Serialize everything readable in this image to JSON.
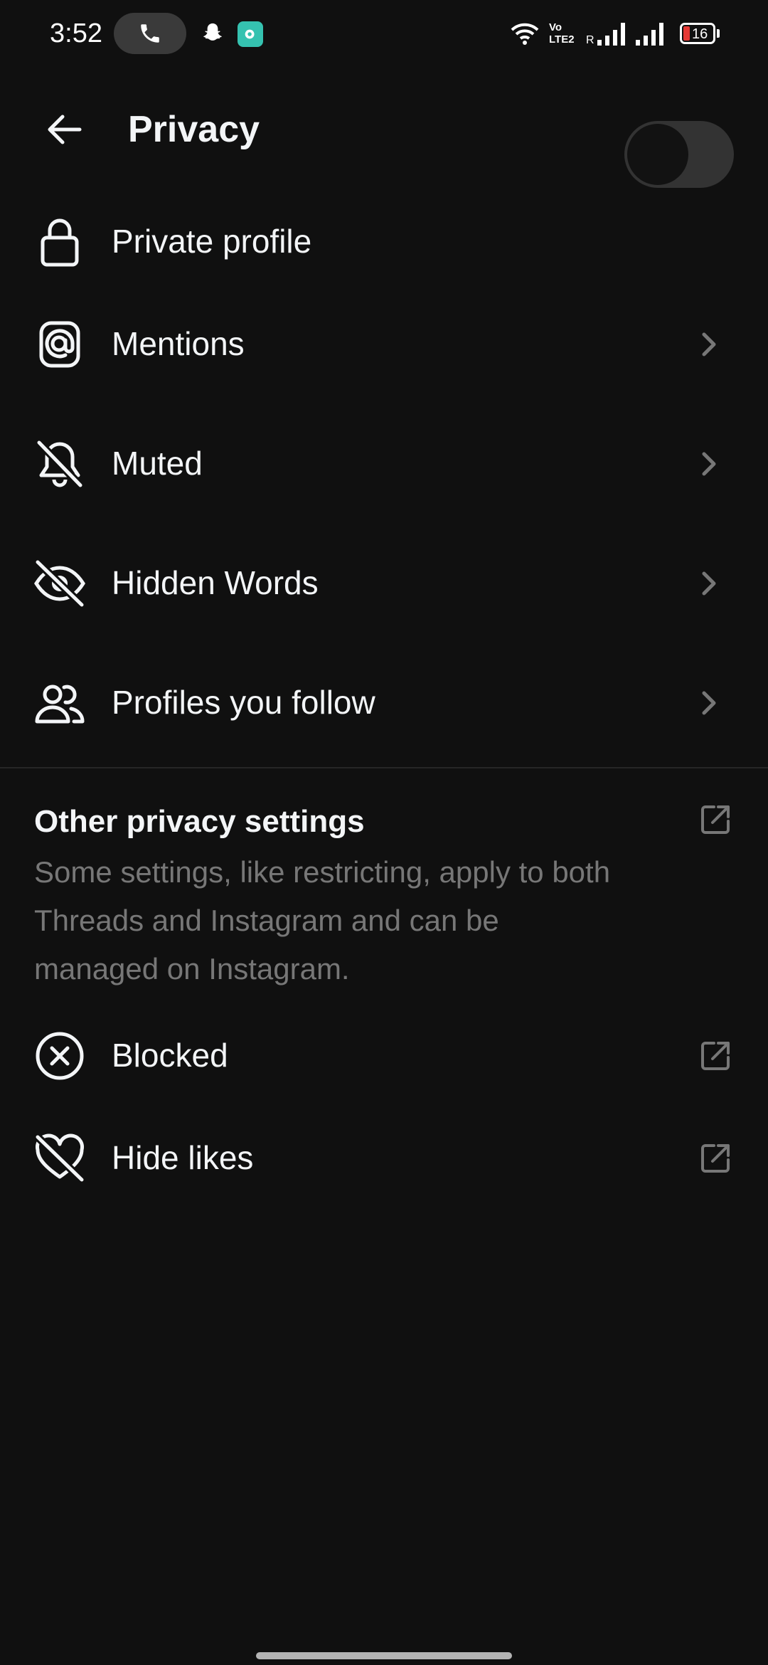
{
  "status_bar": {
    "time": "3:52",
    "icons": [
      "phone-icon",
      "snapchat-icon",
      "app-icon",
      "wifi-icon",
      "volte-icon",
      "signal-icon",
      "signal-icon",
      "battery-icon"
    ],
    "volte_top": "Vo",
    "volte_bottom": "LTE2",
    "roaming": "R",
    "battery_level": "16",
    "battery_color": "#e53935",
    "app_icon_color": "#35c2b0"
  },
  "header": {
    "title": "Privacy",
    "back_icon": "back-arrow-icon"
  },
  "settings": {
    "private_profile": {
      "label": "Private profile",
      "icon": "lock-icon",
      "toggle_on": false
    },
    "mentions": {
      "label": "Mentions",
      "icon": "at-icon"
    },
    "muted": {
      "label": "Muted",
      "icon": "bell-off-icon"
    },
    "hidden_words": {
      "label": "Hidden Words",
      "icon": "eye-off-icon"
    },
    "profiles_you_follow": {
      "label": "Profiles you follow",
      "icon": "people-icon"
    }
  },
  "other_privacy": {
    "title": "Other privacy settings",
    "description": "Some settings, like restricting, apply to both Threads and Instagram and can be managed on Instagram.",
    "items": {
      "blocked": {
        "label": "Blocked",
        "icon": "x-circle-icon"
      },
      "hide_likes": {
        "label": "Hide likes",
        "icon": "heart-off-icon"
      }
    }
  },
  "colors": {
    "background": "#101010",
    "text_primary": "#f3f5f7",
    "text_secondary": "#777777",
    "chevron": "#777777",
    "toggle_track": "#333333"
  }
}
